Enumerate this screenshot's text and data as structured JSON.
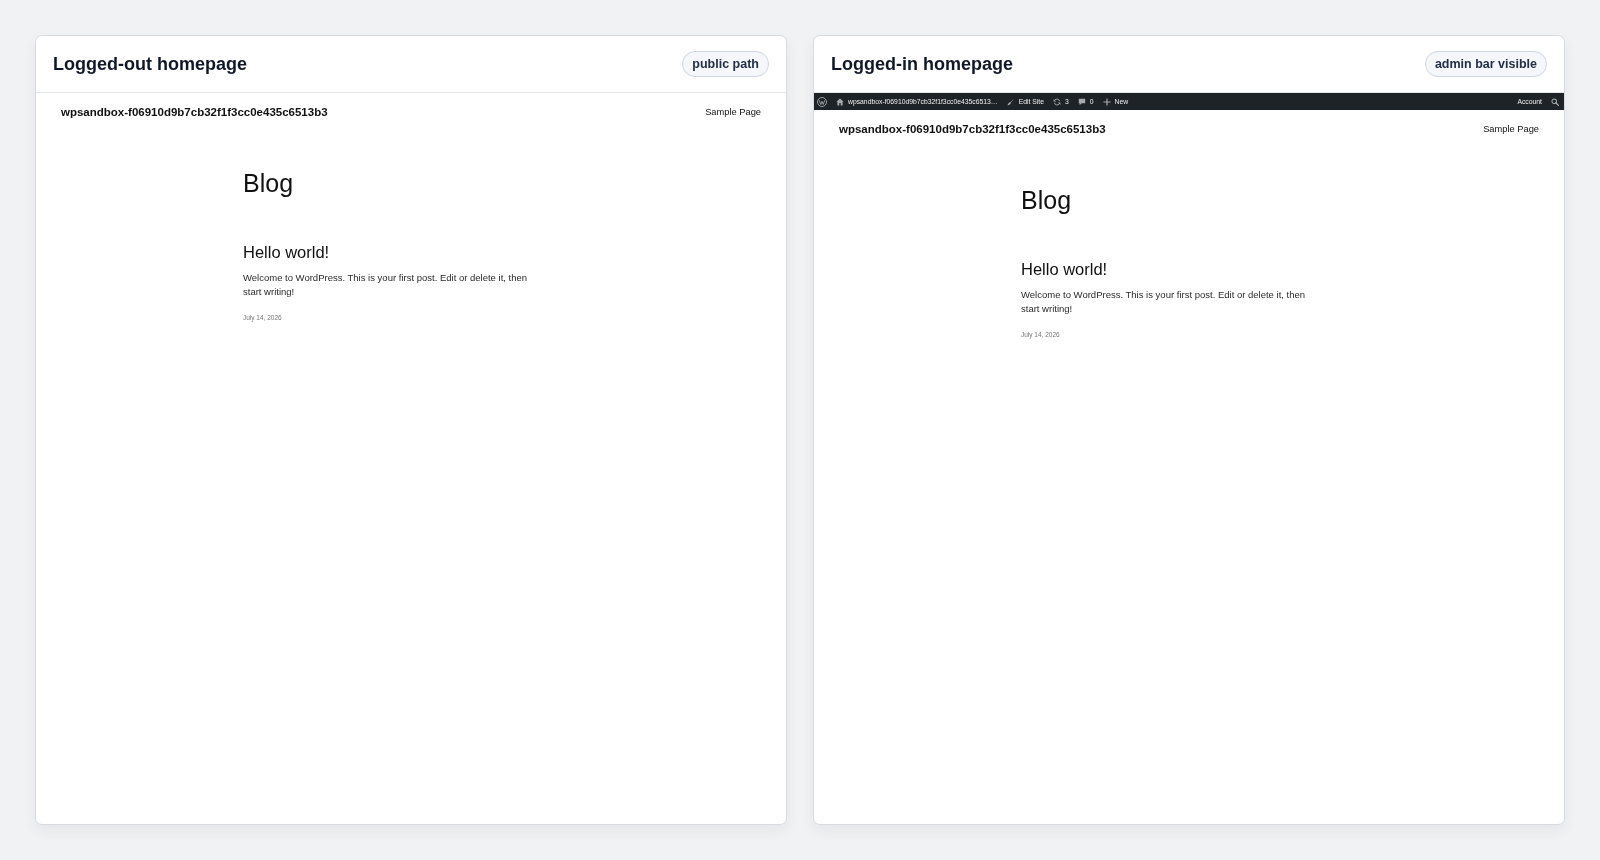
{
  "panels": [
    {
      "title": "Logged-out homepage",
      "badge": "public path",
      "site": {
        "title": "wpsandbox-f06910d9b7cb32f1f3cc0e435c6513b3",
        "nav": [
          "Sample Page"
        ],
        "heading": "Blog",
        "posts": [
          {
            "title": "Hello world!",
            "excerpt": "Welcome to WordPress. This is your first post. Edit or delete it, then start writing!",
            "date": "July 14, 2026"
          }
        ]
      }
    },
    {
      "title": "Logged-in homepage",
      "badge": "admin bar visible",
      "admin_bar": {
        "left": [
          {
            "kind": "logo"
          },
          {
            "kind": "site",
            "label": "wpsandbox-f06910d9b7cb32f1f3cc0e435c6513…"
          },
          {
            "kind": "edit",
            "label": "Edit Site"
          },
          {
            "kind": "updates",
            "label": "3"
          },
          {
            "kind": "comments",
            "label": "0"
          },
          {
            "kind": "new",
            "label": "New"
          }
        ],
        "right": [
          {
            "kind": "account",
            "label": "Account"
          },
          {
            "kind": "search"
          }
        ]
      },
      "site": {
        "title": "wpsandbox-f06910d9b7cb32f1f3cc0e435c6513b3",
        "nav": [
          "Sample Page"
        ],
        "heading": "Blog",
        "posts": [
          {
            "title": "Hello world!",
            "excerpt": "Welcome to WordPress. This is your first post. Edit or delete it, then start writing!",
            "date": "July 14, 2026"
          }
        ]
      }
    }
  ]
}
